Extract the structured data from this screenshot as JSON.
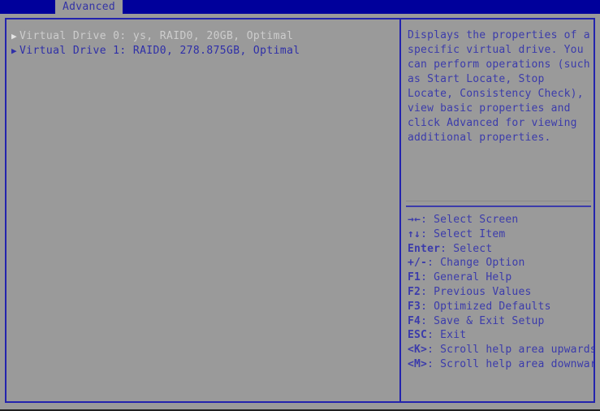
{
  "menubar": {
    "active_tab": "Advanced"
  },
  "main": {
    "drives": [
      {
        "marker": "▶",
        "label": "Virtual Drive 0: ys, RAID0, 20GB, Optimal",
        "state": "dim"
      },
      {
        "marker": "▶",
        "label": "Virtual Drive 1: RAID0, 278.875GB, Optimal",
        "state": "normal"
      }
    ]
  },
  "help": {
    "text": "Displays the properties of a specific virtual drive. You can perform operations (such as Start Locate, Stop Locate, Consistency Check), view basic properties and click Advanced for viewing additional properties."
  },
  "legend": {
    "items": [
      {
        "keys": "→←",
        "desc": ": Select Screen"
      },
      {
        "keys": "↑↓",
        "desc": ": Select Item"
      },
      {
        "keys": "Enter",
        "desc": ": Select"
      },
      {
        "keys": "+/-",
        "desc": ": Change Option"
      },
      {
        "keys": "F1",
        "desc": ": General Help"
      },
      {
        "keys": "F2",
        "desc": ": Previous Values"
      },
      {
        "keys": "F3",
        "desc": ": Optimized Defaults"
      },
      {
        "keys": "F4",
        "desc": ": Save & Exit Setup"
      },
      {
        "keys": "ESC",
        "desc": ": Exit"
      },
      {
        "keys": "<K>",
        "desc": ": Scroll help area upwards"
      },
      {
        "keys": "<M>",
        "desc": ": Scroll help area downwards"
      }
    ]
  },
  "colors": {
    "menubar_bg": "#00009b",
    "screen_bg": "#9a9a9a",
    "border": "#2323ad",
    "text_blue": "#3b3bab",
    "text_dim": "#cdcdcd"
  }
}
